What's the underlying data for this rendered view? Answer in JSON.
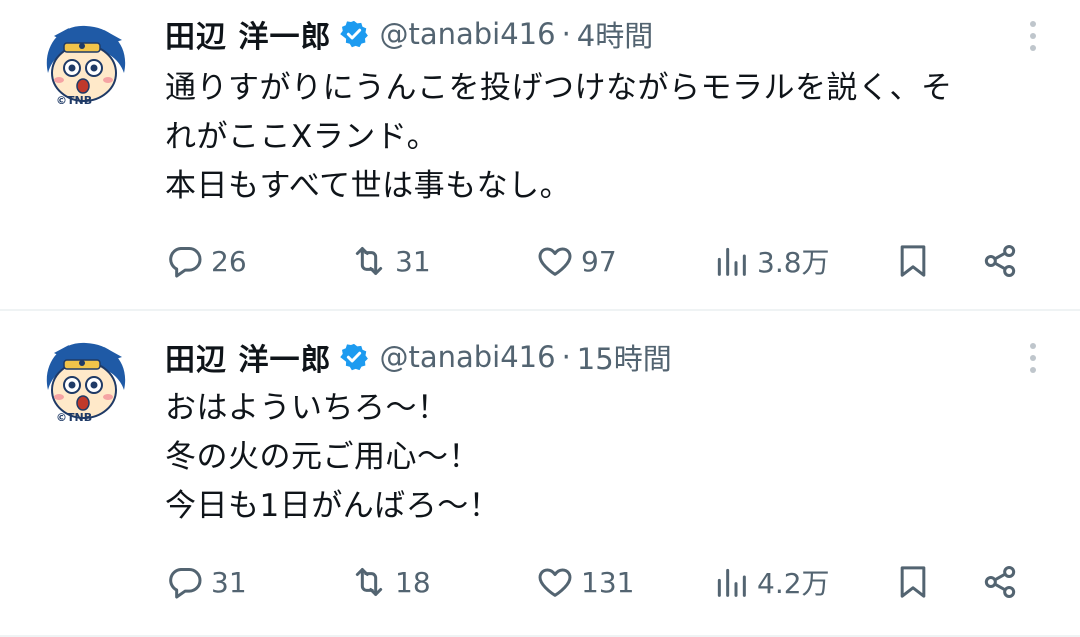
{
  "tweets": [
    {
      "author": {
        "name": "田辺 洋一郎",
        "handle": "@tanabi416",
        "verified": true,
        "avatar_label": "©TNB"
      },
      "separator": "·",
      "time": "4時間",
      "text_lines": [
        "通りすがりにうんこを投げつけながらモラルを説く、そ",
        "れがここXランド。",
        "本日もすべて世は事もなし。"
      ],
      "stats": {
        "replies": "26",
        "retweets": "31",
        "likes": "97",
        "views": "3.8万"
      }
    },
    {
      "author": {
        "name": "田辺 洋一郎",
        "handle": "@tanabi416",
        "verified": true,
        "avatar_label": "©TNB"
      },
      "separator": "·",
      "time": "15時間",
      "text_lines": [
        "おはよういちろ〜！",
        "冬の火の元ご用心〜！",
        "今日も1日がんばろ〜！"
      ],
      "stats": {
        "replies": "31",
        "retweets": "18",
        "likes": "131",
        "views": "4.2万"
      }
    }
  ],
  "colors": {
    "text": "#0f1419",
    "secondary": "#536471",
    "verified": "#1d9bf0",
    "divider": "#eff3f4",
    "avatar_hair": "#1f5aa6"
  },
  "icons": [
    "reply-icon",
    "retweet-icon",
    "like-icon",
    "views-icon",
    "bookmark-icon",
    "share-icon",
    "more-icon",
    "verified-badge-icon"
  ]
}
